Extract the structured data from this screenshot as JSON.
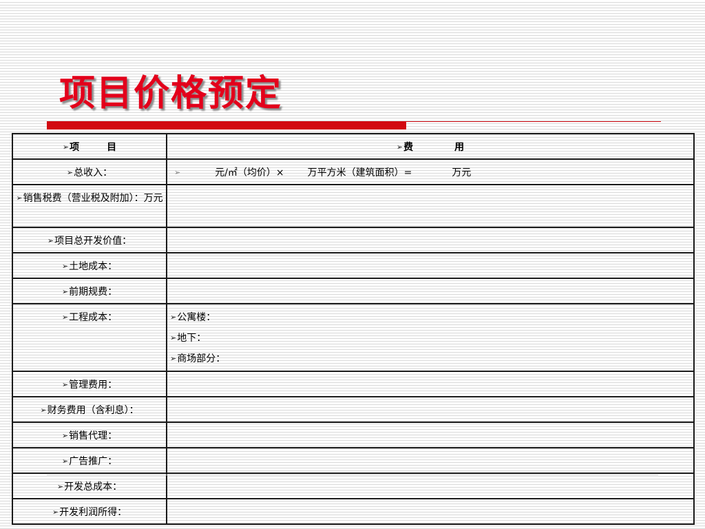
{
  "slide": {
    "title": "项目价格预定"
  },
  "table": {
    "header": {
      "item_a": "项",
      "item_b": "目",
      "cost_a": "费",
      "cost_b": "用"
    },
    "income": {
      "label": "总收入：",
      "seg1": "元/㎡（均价）×",
      "seg2": "万平方米（建筑面积）=",
      "seg3": "万元"
    },
    "rows": {
      "sales_tax": "销售税费（营业税及附加）：万元",
      "total_dev_value": "项目总开发价值：",
      "land_cost": "土地成本：",
      "pre_planning_fee": "前期规费：",
      "engineering_cost": "工程成本：",
      "management_fee": "管理费用：",
      "finance_fee": "财务费用（含利息）：",
      "sales_agency": "销售代理：",
      "advertising": "广告推广：",
      "total_dev_cost": "开发总成本：",
      "dev_profit": "开发利润所得："
    },
    "engineering_sub": {
      "apartment": "公寓楼：",
      "underground": "地下：",
      "mall": "商场部分："
    }
  },
  "icons": {
    "bullet": "➢"
  },
  "colors": {
    "title_red": "#e3001b",
    "rule_red": "#d20a11",
    "grid_line": "#1a1a1a"
  }
}
